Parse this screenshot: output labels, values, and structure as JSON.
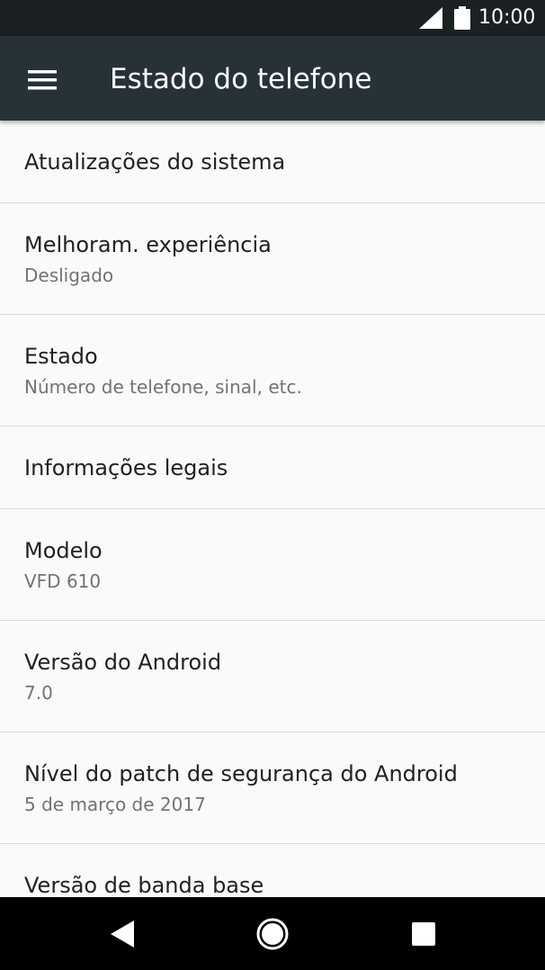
{
  "status_bar": {
    "time": "10:00",
    "signal_icon": "cell-signal-icon",
    "battery_icon": "battery-full-icon"
  },
  "app_bar": {
    "title": "Estado do telefone",
    "menu_icon": "hamburger-menu-icon"
  },
  "items": [
    {
      "title": "Atualizações do sistema",
      "summary": ""
    },
    {
      "title": "Melhoram. experiência",
      "summary": "Desligado"
    },
    {
      "title": "Estado",
      "summary": "Número de telefone, sinal, etc."
    },
    {
      "title": "Informações legais",
      "summary": ""
    },
    {
      "title": "Modelo",
      "summary": "VFD 610"
    },
    {
      "title": "Versão do Android",
      "summary": "7.0"
    },
    {
      "title": "Nível do patch de segurança do Android",
      "summary": "5 de março de 2017"
    },
    {
      "title": "Versão de banda base",
      "summary": ""
    }
  ],
  "nav_bar": {
    "back_icon": "back-triangle-icon",
    "home_icon": "home-circle-icon",
    "recents_icon": "recents-square-icon"
  },
  "colors": {
    "status_bar": "#1b2023",
    "app_bar": "#263238",
    "background": "#fafafa",
    "primary_text": "#212121",
    "secondary_text": "#737373",
    "divider": "#dcdcdc",
    "nav_bar": "#000000"
  }
}
